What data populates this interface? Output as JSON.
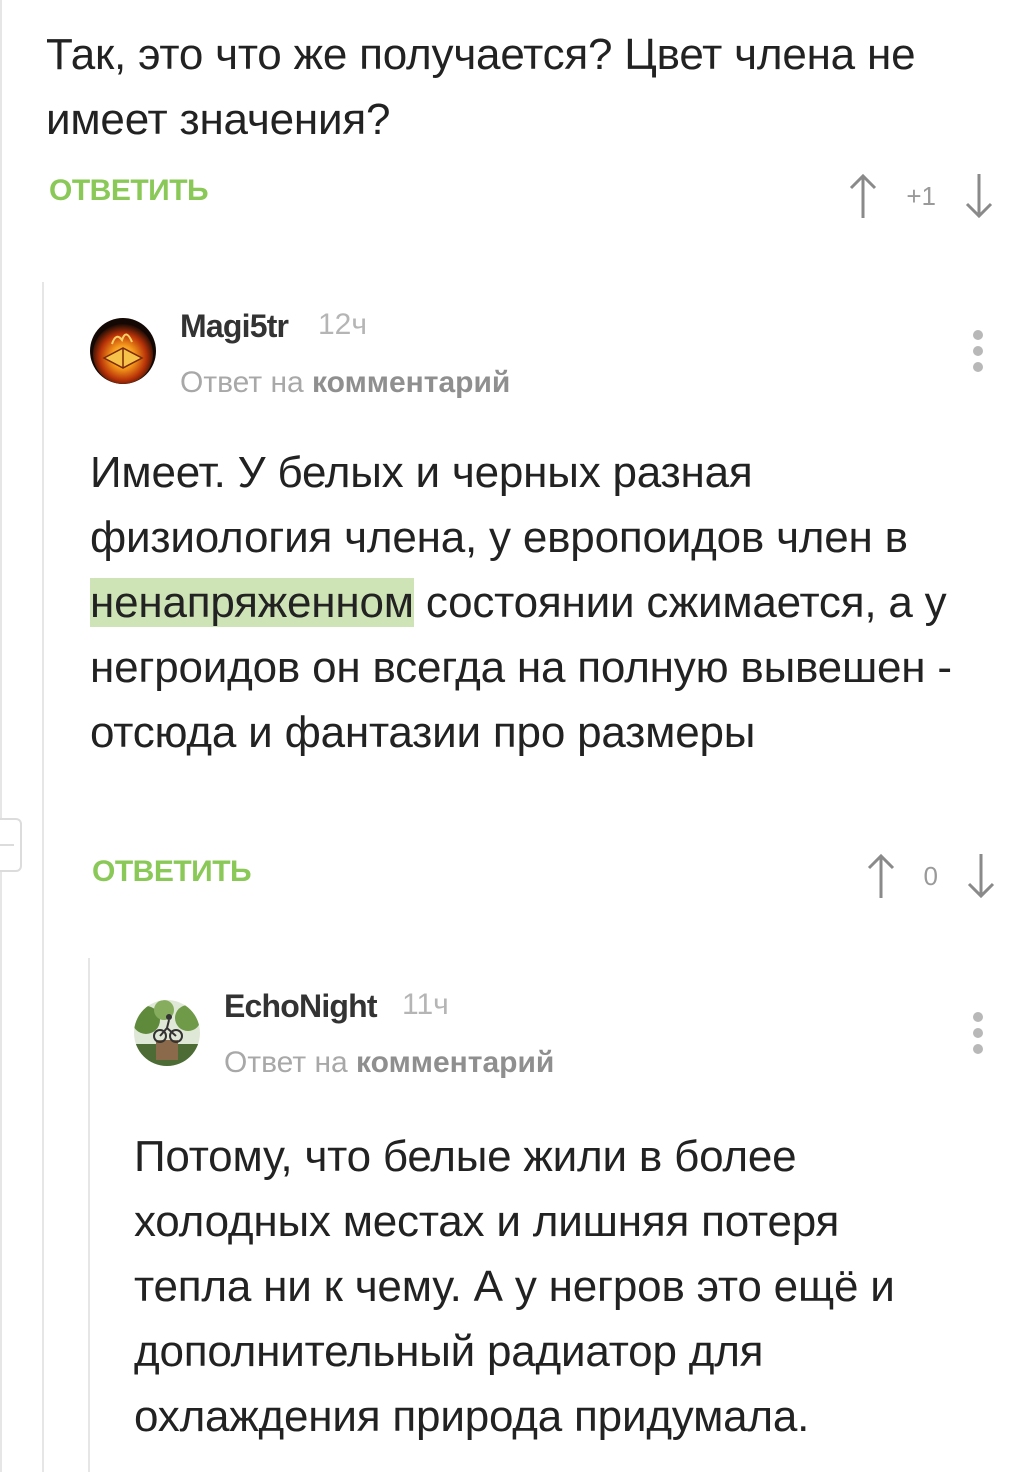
{
  "comments": [
    {
      "text": "Так, это что же получается? Цвет члена не имеет значения?",
      "reply_label": "ОТВЕТИТЬ",
      "rating": "+1"
    },
    {
      "author": "Magi5tr",
      "time": "12ч",
      "reply_prefix": "Ответ на",
      "reply_target": "комментарий",
      "text_before": "Имеет. У белых и черных разная физиология члена, у европоидов член в ",
      "text_highlight": "ненапряженном",
      "text_after": " состоянии сжимается, а у негроидов он всегда на полную вывешен - отсюда и фантазии про размеры",
      "reply_label": "ОТВЕТИТЬ",
      "rating": "0",
      "avatar_icon": "burning-book-avatar"
    },
    {
      "author": "EchoNight",
      "time": "11ч",
      "reply_prefix": "Ответ на",
      "reply_target": "комментарий",
      "text": "Потому, что белые жили в более холодных местах и лишняя потеря тепла ни к чему. А у негров это ещё и дополнительный радиатор для охлаждения природа придумала.",
      "avatar_icon": "cyclist-monument-avatar"
    }
  ],
  "icons": {
    "up": "arrow-up-icon",
    "down": "arrow-down-icon",
    "more": "more-vertical-icon"
  },
  "colors": {
    "accent": "#8ac858",
    "highlight": "#cfe4b6",
    "muted": "#a8a8a8"
  }
}
